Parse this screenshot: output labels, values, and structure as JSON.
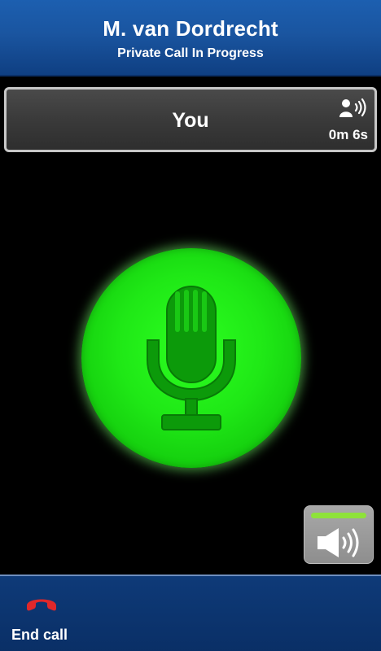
{
  "header": {
    "title": "M. van Dordrecht",
    "subtitle": "Private Call In Progress"
  },
  "speaker_bar": {
    "name": "You",
    "duration": "0m 6s",
    "icon": "person-talking-icon"
  },
  "ptt_button": {
    "icon": "microphone-icon",
    "color": "#1fe816"
  },
  "speakerphone": {
    "icon": "speaker-icon",
    "indicator_color": "#8ee23a"
  },
  "footer": {
    "end_call_label": "End call",
    "end_call_icon": "hang-up-icon",
    "end_call_color": "#e0282a"
  }
}
